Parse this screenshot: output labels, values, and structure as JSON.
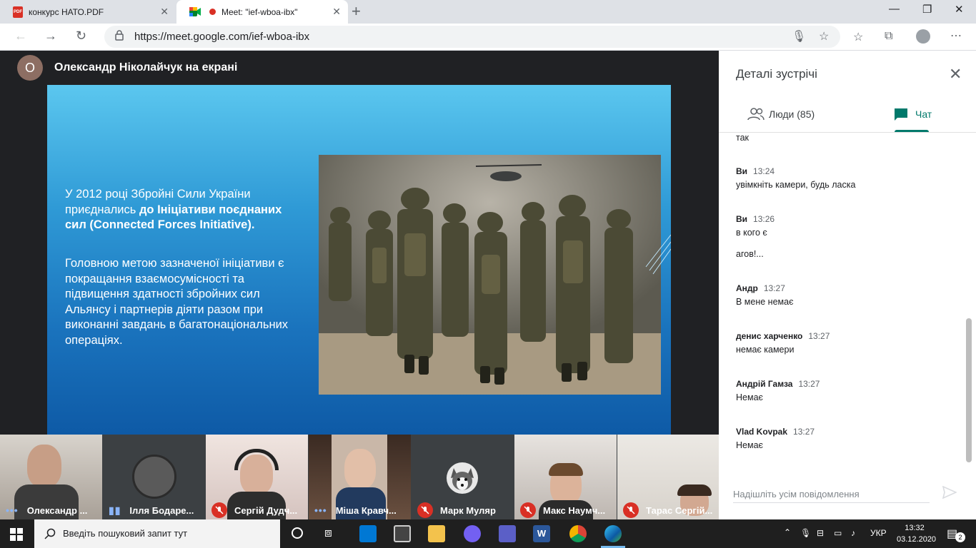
{
  "browser": {
    "tabs": [
      {
        "label": "конкурс НАТО.PDF",
        "icon": "pdf-icon",
        "active": false
      },
      {
        "label": "Meet: \"ief-wboa-ibx\"",
        "icon": "meet-icon",
        "active": true
      }
    ],
    "url": "https://meet.google.com/ief-wboa-ibx"
  },
  "presenter": {
    "initial": "О",
    "label": "Олександр Ніколайчук на екрані"
  },
  "slide": {
    "p1_start": "У 2012 році Збройні Сили України приєднались ",
    "p1_bold": "до Ініціативи поєднаних сил (Connected Forces Initiative).",
    "p2": "Головною метою зазначеної ініціативи є покращання взаємосумісності та підвищення здатності збройних сил Альянсу і партнерів діяти разом при виконанні завдань в багатонаціональних операціях."
  },
  "participants": [
    {
      "name": "Олександр ...",
      "status": "speaking-dots"
    },
    {
      "name": "Ілля Бодаре...",
      "status": "speaking-bars"
    },
    {
      "name": "Сергій Дудч...",
      "status": "muted"
    },
    {
      "name": "Міша Кравч...",
      "status": "speaking-dots"
    },
    {
      "name": "Марк Муляр",
      "status": "muted"
    },
    {
      "name": "Макс Наумч...",
      "status": "muted"
    },
    {
      "name": "Тарас Сергій...",
      "status": "muted"
    }
  ],
  "panel": {
    "title": "Деталі зустрічі",
    "people_tab": "Люди (85)",
    "chat_tab": "Чат",
    "messages": [
      {
        "sender": "",
        "time": "",
        "lines": [
          "так"
        ]
      },
      {
        "sender": "Ви",
        "time": "13:24",
        "lines": [
          "увімкніть камери, будь ласка"
        ]
      },
      {
        "sender": "Ви",
        "time": "13:26",
        "lines": [
          "в кого є",
          "агов!..."
        ]
      },
      {
        "sender": "Андр",
        "time": "13:27",
        "lines": [
          "В мене немає"
        ]
      },
      {
        "sender": "денис харченко",
        "time": "13:27",
        "lines": [
          "немає камери"
        ]
      },
      {
        "sender": "Андрій Гамза",
        "time": "13:27",
        "lines": [
          "Немає"
        ]
      },
      {
        "sender": "Vlad Kovpak",
        "time": "13:27",
        "lines": [
          "Немає"
        ]
      }
    ],
    "composer_placeholder": "Надішліть усім повідомлення"
  },
  "taskbar": {
    "search_placeholder": "Введіть пошуковий запит тут",
    "language": "УКР",
    "time": "13:32",
    "date": "03.12.2020",
    "notifications": "2"
  }
}
